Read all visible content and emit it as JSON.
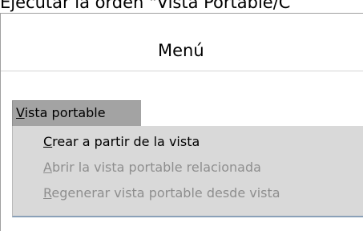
{
  "caption": "Ejecutar la orden \"Vista Portable/C",
  "dialog": {
    "title": "Menú"
  },
  "menubar": {
    "item": {
      "mnemonic": "V",
      "rest": "ista portable"
    }
  },
  "dropdown": {
    "items": [
      {
        "mnemonic": "C",
        "rest": "rear a partir de la vista",
        "enabled": true
      },
      {
        "mnemonic": "A",
        "rest": "brir la vista portable relacionada",
        "enabled": false
      },
      {
        "mnemonic": "R",
        "rest": "egenerar vista portable desde vista",
        "enabled": false
      }
    ]
  }
}
